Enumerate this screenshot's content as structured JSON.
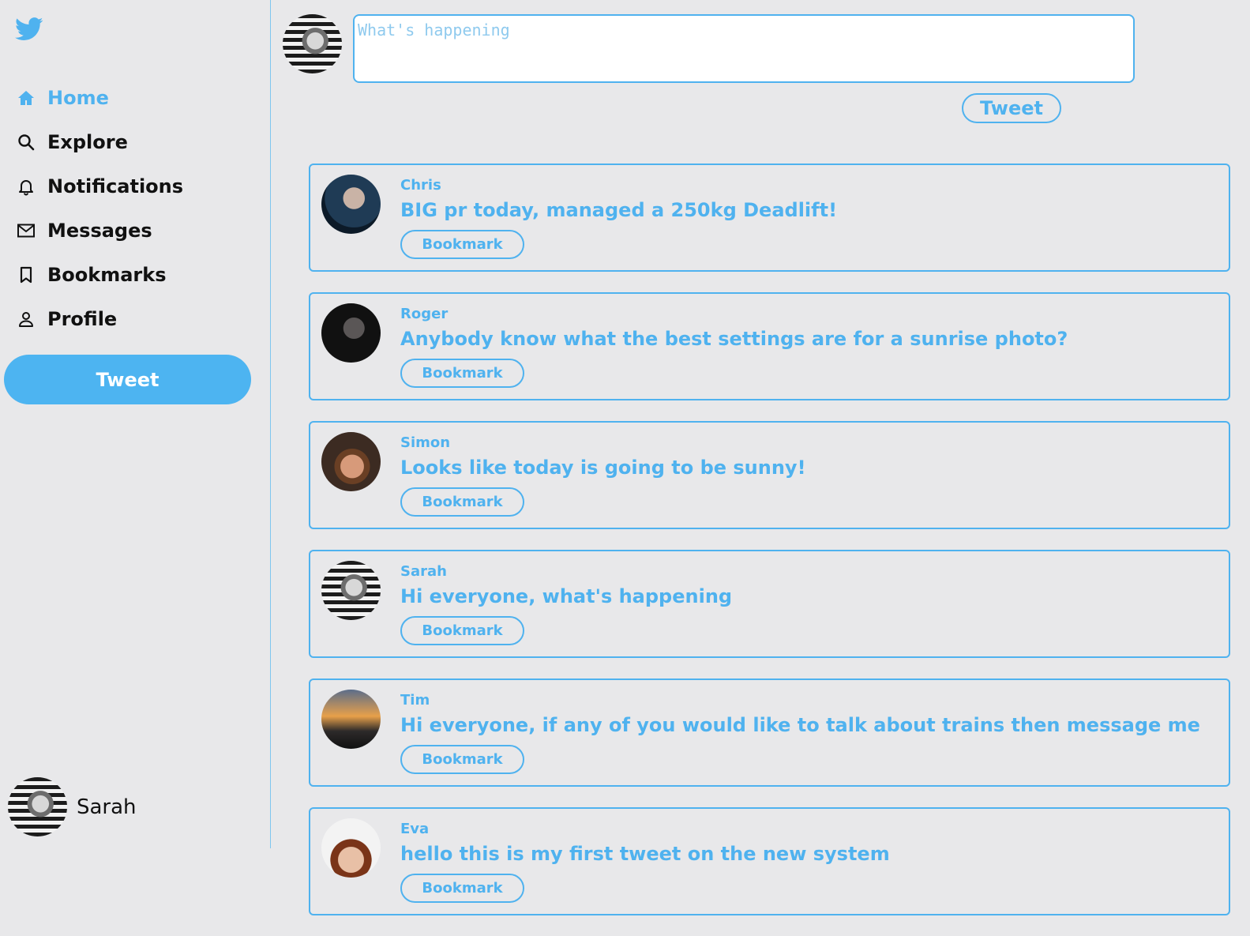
{
  "colors": {
    "accent": "#4fb2ef",
    "background": "#e8e8ea"
  },
  "logo": {
    "icon": "twitter-bird-icon"
  },
  "nav": [
    {
      "label": "Home",
      "icon": "home-icon",
      "active": true
    },
    {
      "label": "Explore",
      "icon": "search-icon",
      "active": false
    },
    {
      "label": "Notifications",
      "icon": "bell-icon",
      "active": false
    },
    {
      "label": "Messages",
      "icon": "mail-icon",
      "active": false
    },
    {
      "label": "Bookmarks",
      "icon": "bookmark-icon",
      "active": false
    },
    {
      "label": "Profile",
      "icon": "person-icon",
      "active": false
    }
  ],
  "sidebar": {
    "tweet_label": "Tweet"
  },
  "current_user": {
    "name": "Sarah"
  },
  "composer": {
    "placeholder": "What's happening",
    "value": "",
    "tweet_label": "Tweet"
  },
  "feed": [
    {
      "user": "Chris",
      "text": "BIG pr today, managed a 250kg Deadlift!",
      "bookmark_label": "Bookmark"
    },
    {
      "user": "Roger",
      "text": "Anybody know what the best settings are for a sunrise photo?",
      "bookmark_label": "Bookmark"
    },
    {
      "user": "Simon",
      "text": "Looks like today is going to be sunny!",
      "bookmark_label": "Bookmark"
    },
    {
      "user": "Sarah",
      "text": "Hi everyone, what's happening",
      "bookmark_label": "Bookmark"
    },
    {
      "user": "Tim",
      "text": "Hi everyone, if any of you would like to talk about trains then message me",
      "bookmark_label": "Bookmark"
    },
    {
      "user": "Eva",
      "text": "hello this is my first tweet on the new system",
      "bookmark_label": "Bookmark"
    }
  ]
}
